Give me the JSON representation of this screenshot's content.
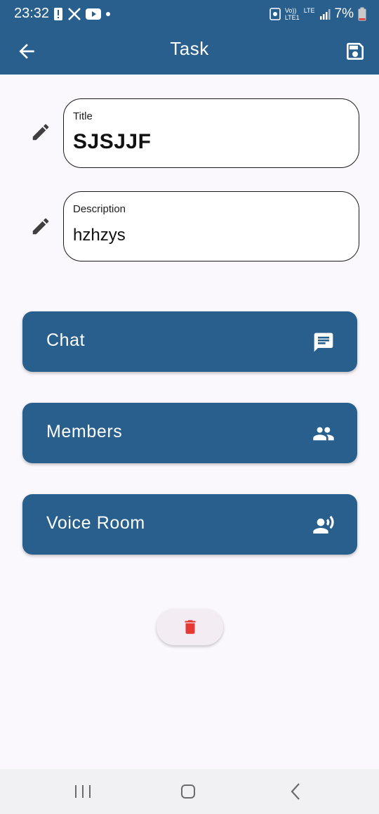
{
  "status_bar": {
    "time": "23:32",
    "left_icons": [
      "alert-icon",
      "x-app-icon",
      "youtube-icon",
      "dot-icon"
    ],
    "signal_label_top": "Vo))",
    "signal_label_bottom": "LTE1",
    "lte_label": "LTE",
    "battery": "7%"
  },
  "app_bar": {
    "title": "Task",
    "back_icon": "arrow-back-icon",
    "save_icon": "save-icon"
  },
  "fields": {
    "title": {
      "label": "Title",
      "value": "SJSJJF"
    },
    "description": {
      "label": "Description",
      "value": "hzhzys"
    }
  },
  "buttons": [
    {
      "label": "Chat",
      "icon": "chat-icon"
    },
    {
      "label": "Members",
      "icon": "group-icon"
    },
    {
      "label": "Voice Room",
      "icon": "voice-icon"
    }
  ],
  "delete_icon": "trash-icon",
  "nav_bar": {
    "items": [
      "recents-icon",
      "home-icon",
      "back-icon"
    ]
  },
  "colors": {
    "primary": "#285F8C",
    "background": "#FBF8FD",
    "delete": "#E53935",
    "on_primary": "#FFFFFF"
  }
}
